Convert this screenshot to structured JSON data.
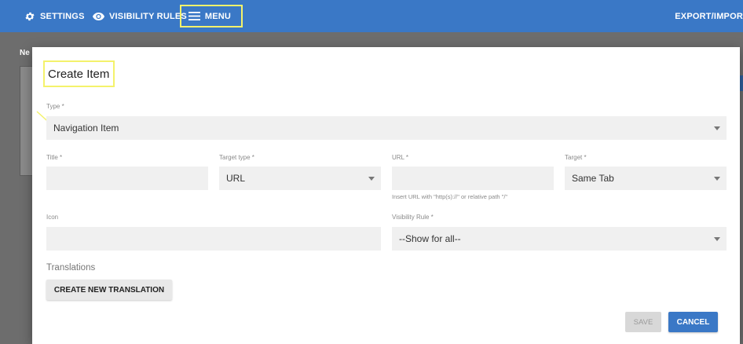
{
  "nav": {
    "settings_label": "SETTINGS",
    "visibility_label": "VISIBILITY RULES",
    "menu_label": "MENU",
    "export_label": "EXPORT/IMPOR"
  },
  "background": {
    "title": "Ne"
  },
  "modal": {
    "title": "Create Item",
    "type": {
      "label": "Type *",
      "value": "Navigation Item"
    },
    "title_field": {
      "label": "Title *",
      "value": ""
    },
    "target_type": {
      "label": "Target type *",
      "value": "URL"
    },
    "url": {
      "label": "URL *",
      "value": "",
      "hint": "Insert URL with \"http(s)://\" or relative path \"/\""
    },
    "target": {
      "label": "Target *",
      "value": "Same Tab"
    },
    "icon": {
      "label": "Icon",
      "value": ""
    },
    "visibility_rule": {
      "label": "Visibility Rule *",
      "value": "--Show for all--"
    },
    "translations_heading": "Translations",
    "create_translation_label": "CREATE NEW TRANSLATION",
    "save_label": "SAVE",
    "cancel_label": "CANCEL"
  },
  "colors": {
    "topbar": "#3a78c6",
    "highlight": "#f4f26b",
    "field_bg": "#f0f0f0",
    "primary_button": "#3a78c6"
  },
  "icons": [
    "gear-icon",
    "eye-icon",
    "hamburger-icon",
    "chevron-down-icon"
  ]
}
